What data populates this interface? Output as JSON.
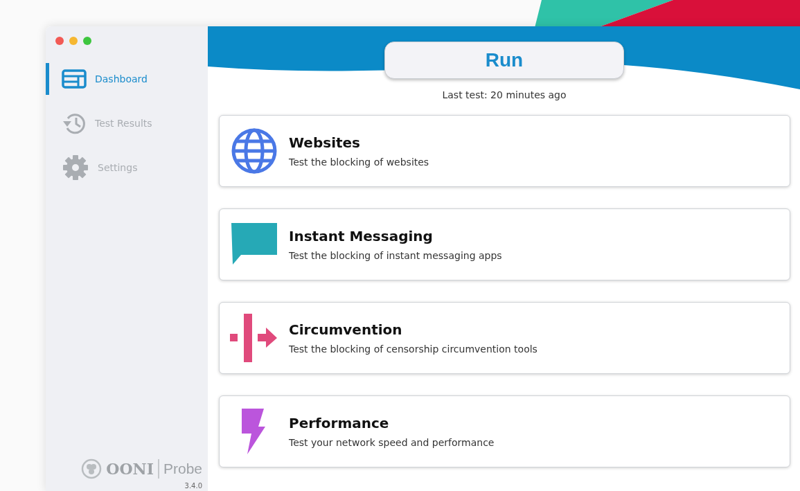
{
  "window": {
    "controls": [
      {
        "color": "#f25a55"
      },
      {
        "color": "#f6b731"
      },
      {
        "color": "#3ec63f"
      }
    ]
  },
  "sidebar": {
    "items": [
      {
        "kind": "dashboard",
        "label": "Dashboard",
        "selected": true
      },
      {
        "kind": "history",
        "label": "Test Results",
        "selected": false
      },
      {
        "kind": "settings",
        "label": "Settings",
        "selected": false
      }
    ],
    "logo": {
      "name": "OONI",
      "product": "Probe",
      "version": "3.4.0"
    }
  },
  "run_button": {
    "label": "Run"
  },
  "last_test": "Last test:  20 minutes ago",
  "tests": [
    {
      "kind": "websites",
      "title": "Websites",
      "description": "Test the blocking of websites"
    },
    {
      "kind": "messaging",
      "title": "Instant Messaging",
      "description": "Test the blocking of instant messaging apps"
    },
    {
      "kind": "circumvention",
      "title": "Circumvention",
      "description": "Test the blocking of censorship circumvention tools"
    },
    {
      "kind": "performance",
      "title": "Performance",
      "description": "Test your network speed and performance"
    }
  ]
}
